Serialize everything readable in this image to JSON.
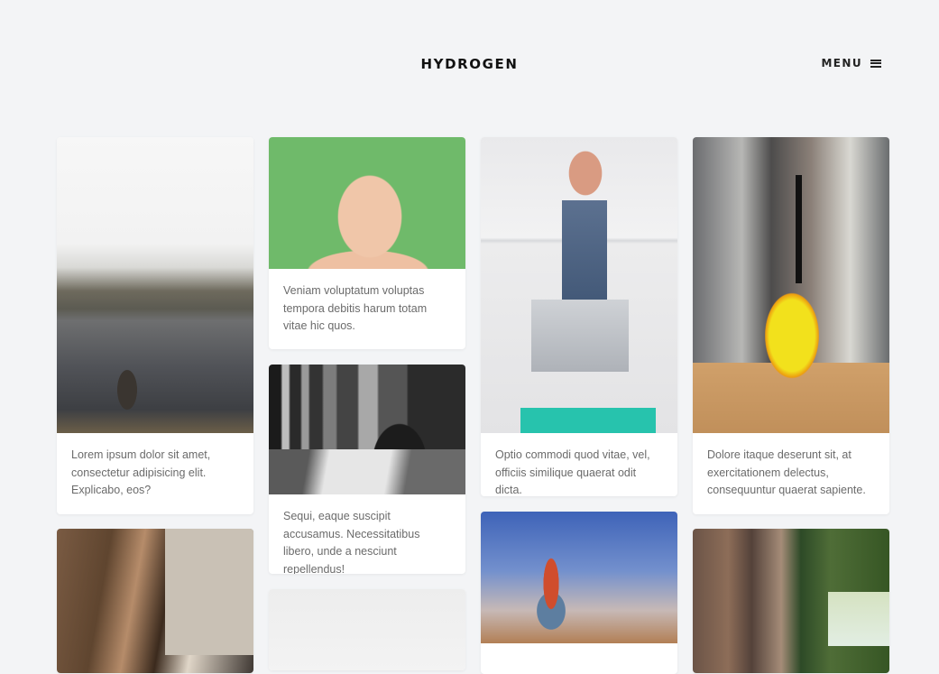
{
  "header": {
    "logo": "HYDROGEN",
    "menu_label": "MENU"
  },
  "posts": [
    {
      "text": "Lorem ipsum dolor sit amet, consectetur adipisicing elit. Explicabo, eos?"
    },
    {
      "text": "Veniam voluptatum voluptas tempora debitis harum totam vitae hic quos."
    },
    {
      "text": "Sequi, eaque suscipit accusamus. Necessitatibus libero, unde a nesciunt repellendus!"
    },
    {
      "text": "Optio commodi quod vitae, vel, officiis similique quaerat odit dicta."
    },
    {
      "text": "Dolore itaque deserunt sit, at exercitationem delectus, consequuntur quaerat sapiente."
    }
  ],
  "colors": {
    "background": "#f3f4f6",
    "card": "#ffffff",
    "text": "#6b6b6b",
    "logo": "#111111"
  }
}
